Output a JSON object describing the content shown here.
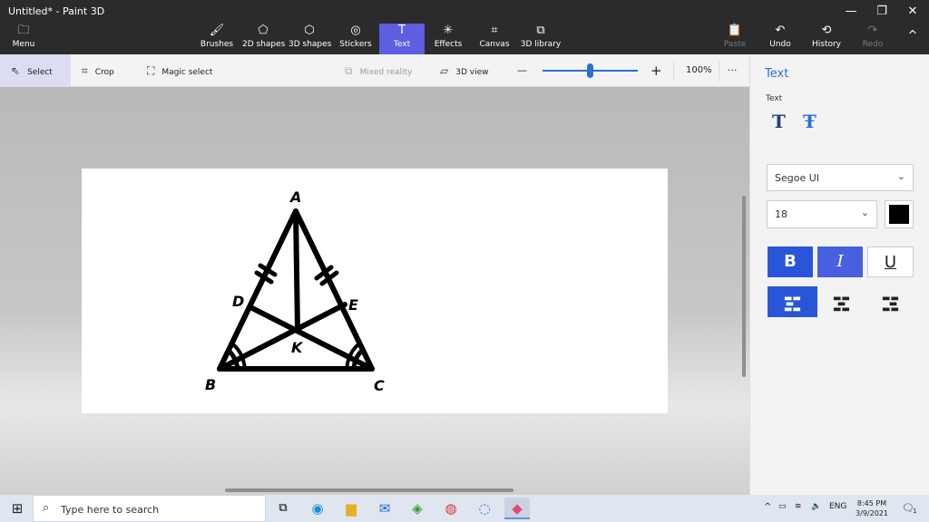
{
  "window": {
    "title": "Untitled* - Paint 3D",
    "controls": {
      "minimize": "—",
      "restore": "❐",
      "close": "✕"
    }
  },
  "ribbon": {
    "menu_label": "Menu",
    "tabs": [
      {
        "id": "brushes",
        "label": "Brushes",
        "icon": "🖌"
      },
      {
        "id": "2dshapes",
        "label": "2D shapes",
        "icon": "⬠"
      },
      {
        "id": "3dshapes",
        "label": "3D shapes",
        "icon": "⬡"
      },
      {
        "id": "stickers",
        "label": "Stickers",
        "icon": "◎"
      },
      {
        "id": "text",
        "label": "Text",
        "icon": "T"
      },
      {
        "id": "effects",
        "label": "Effects",
        "icon": "✳"
      },
      {
        "id": "canvas",
        "label": "Canvas",
        "icon": "⌗"
      },
      {
        "id": "3dlibrary",
        "label": "3D library",
        "icon": "⧉"
      }
    ],
    "active_tab": "Text",
    "paste_label": "Paste",
    "undo_label": "Undo",
    "history_label": "History",
    "redo_label": "Redo",
    "collapse_icon": "^"
  },
  "toolstrip": {
    "select_label": "Select",
    "crop_label": "Crop",
    "magic_select_label": "Magic select",
    "mixed_reality_label": "Mixed reality",
    "view3d_label": "3D view",
    "zoom_minus": "—",
    "zoom_plus": "+",
    "zoom_level": "100%",
    "zoom_fraction": 0.5,
    "more_label": "···"
  },
  "drawing": {
    "labels": {
      "A": "A",
      "B": "B",
      "C": "C",
      "D": "D",
      "E": "E",
      "K": "K"
    }
  },
  "panel": {
    "title": "Text",
    "subtitle": "Text",
    "font_name": "Segoe UI",
    "font_size": "18",
    "text_color": "#000000",
    "bold_label": "B",
    "italic_label": "I",
    "underline_label": "U",
    "bold_on": true,
    "italic_on": true,
    "underline_on": false,
    "align_left_on": true
  },
  "taskbar": {
    "search_placeholder": "Type here to search",
    "language": "ENG",
    "time": "8:45 PM",
    "date": "3/9/2021",
    "notification_count": "1"
  },
  "colors": {
    "accent": "#2956d8",
    "ribbon_active": "#5e5ee0",
    "titlebar": "#2b2b2b"
  }
}
